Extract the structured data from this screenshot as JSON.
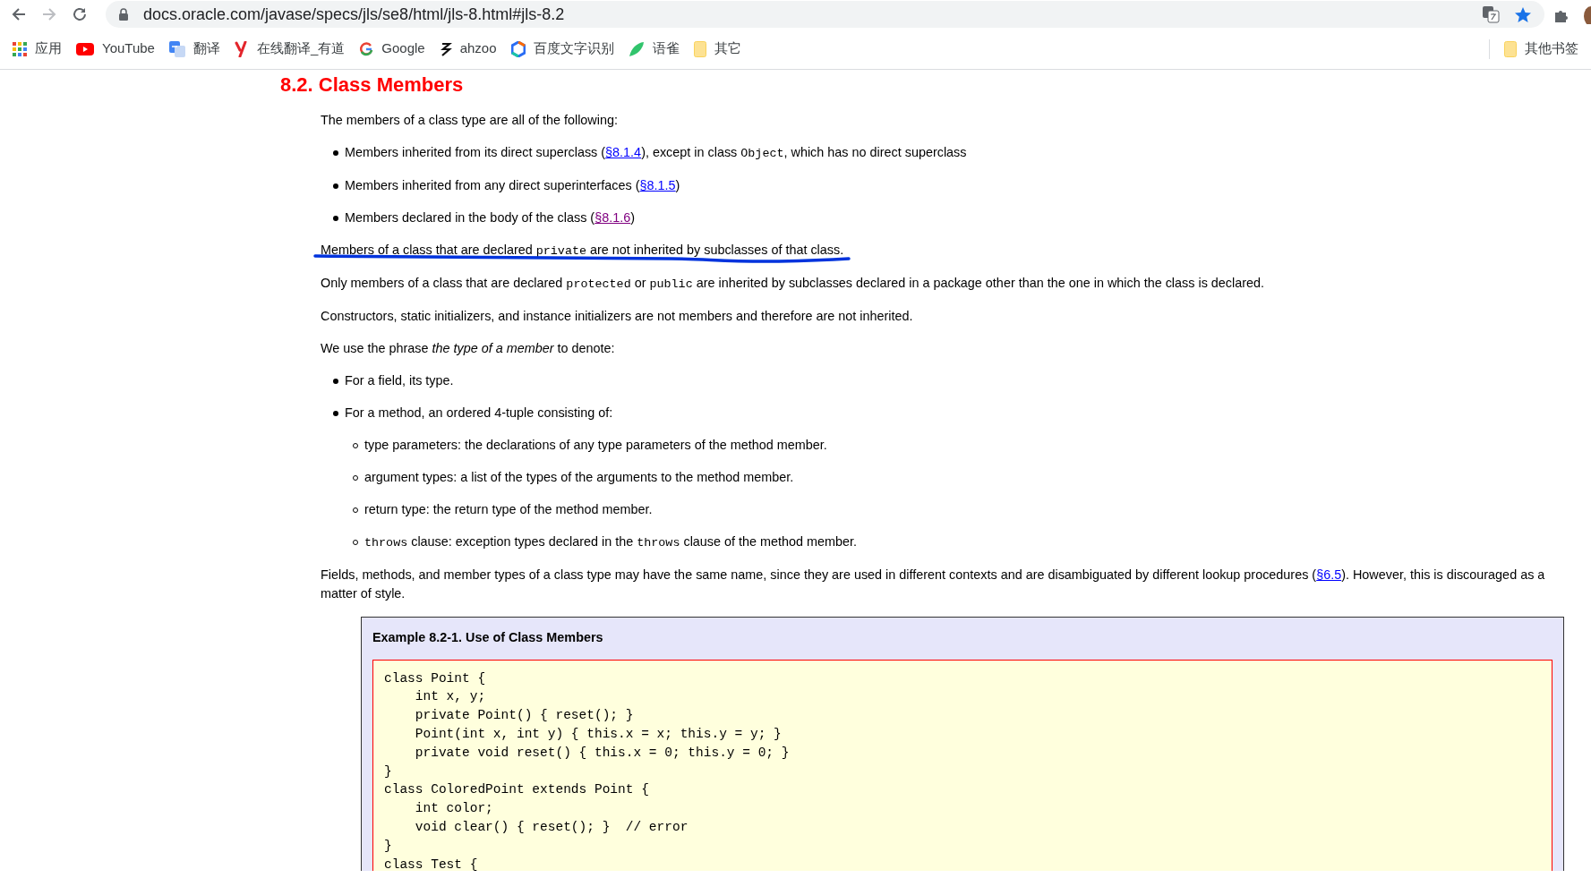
{
  "toolbar": {
    "nav": [
      {
        "kind": "back",
        "disabled": false
      },
      {
        "kind": "forward",
        "disabled": true
      },
      {
        "kind": "reload",
        "disabled": false
      }
    ],
    "url": "docs.oracle.com/javase/specs/jls/se8/html/jls-8.html#jls-8.2",
    "bookmarked": true
  },
  "bookmarks": [
    {
      "kind": "apps",
      "label": "应用"
    },
    {
      "kind": "youtube",
      "label": "YouTube"
    },
    {
      "kind": "translate",
      "label": "翻译"
    },
    {
      "kind": "youdao",
      "label": "在线翻译_有道"
    },
    {
      "kind": "google",
      "label": "Google"
    },
    {
      "kind": "ahzoo",
      "label": "ahzoo"
    },
    {
      "kind": "baidu",
      "label": "百度文字识别"
    },
    {
      "kind": "yuque",
      "label": "语雀"
    },
    {
      "kind": "folder",
      "label": "其它"
    }
  ],
  "other_bookmarks": {
    "label": "其他书签"
  },
  "heading": "8.2. Class Members",
  "blocks": [
    {
      "kind": "para",
      "segments": [
        {
          "kind": "text",
          "text": "The members of a class type are all of the following:"
        }
      ]
    },
    {
      "kind": "list",
      "items": [
        {
          "segments": [
            {
              "kind": "text",
              "text": "Members inherited from its direct superclass ("
            },
            {
              "kind": "link",
              "text": "§8.1.4",
              "visited": false
            },
            {
              "kind": "text",
              "text": "), except in class "
            },
            {
              "kind": "code",
              "text": "Object"
            },
            {
              "kind": "text",
              "text": ", which has no direct superclass"
            }
          ]
        },
        {
          "segments": [
            {
              "kind": "text",
              "text": "Members inherited from any direct superinterfaces ("
            },
            {
              "kind": "link",
              "text": "§8.1.5",
              "visited": false
            },
            {
              "kind": "text",
              "text": ")"
            }
          ]
        },
        {
          "segments": [
            {
              "kind": "text",
              "text": "Members declared in the body of the class ("
            },
            {
              "kind": "link",
              "text": "§8.1.6",
              "visited": true
            },
            {
              "kind": "text",
              "text": ")"
            }
          ]
        }
      ]
    },
    {
      "kind": "para",
      "pen_underline": true,
      "segments": [
        {
          "kind": "text",
          "text": "Members of a class that are declared "
        },
        {
          "kind": "code",
          "text": "private"
        },
        {
          "kind": "text",
          "text": " are not inherited by subclasses of that class."
        }
      ]
    },
    {
      "kind": "para",
      "segments": [
        {
          "kind": "text",
          "text": "Only members of a class that are declared "
        },
        {
          "kind": "code",
          "text": "protected"
        },
        {
          "kind": "text",
          "text": " or "
        },
        {
          "kind": "code",
          "text": "public"
        },
        {
          "kind": "text",
          "text": " are inherited by subclasses declared in a package other than the one in which the class is declared."
        }
      ]
    },
    {
      "kind": "para",
      "segments": [
        {
          "kind": "text",
          "text": "Constructors, static initializers, and instance initializers are not members and therefore are not inherited."
        }
      ]
    },
    {
      "kind": "para",
      "segments": [
        {
          "kind": "text",
          "text": "We use the phrase *the type of a member* to denote:"
        }
      ]
    },
    {
      "kind": "list",
      "items": [
        {
          "segments": [
            {
              "kind": "text",
              "text": "For a field, its type."
            }
          ]
        },
        {
          "segments": [
            {
              "kind": "text",
              "text": "For a method, an ordered 4-tuple consisting of:"
            }
          ],
          "children": [
            {
              "segments": [
                {
                  "kind": "text",
                  "text": "type parameters: the declarations of any type parameters of the method member."
                }
              ]
            },
            {
              "segments": [
                {
                  "kind": "text",
                  "text": "argument types: a list of the types of the arguments to the method member."
                }
              ]
            },
            {
              "segments": [
                {
                  "kind": "text",
                  "text": "return type: the return type of the method member."
                }
              ]
            },
            {
              "segments": [
                {
                  "kind": "code",
                  "text": "throws"
                },
                {
                  "kind": "text",
                  "text": " clause: exception types declared in the "
                },
                {
                  "kind": "code",
                  "text": "throws"
                },
                {
                  "kind": "text",
                  "text": " clause of the method member."
                }
              ]
            }
          ]
        }
      ]
    },
    {
      "kind": "para",
      "segments": [
        {
          "kind": "text",
          "text": "Fields, methods, and member types of a class type may have the same name, since they are used in different contexts and are disambiguated by different lookup procedures ("
        },
        {
          "kind": "link",
          "text": "§6.5",
          "visited": false
        },
        {
          "kind": "text",
          "text": "). However, this is discouraged as a matter of style."
        }
      ]
    }
  ],
  "example": {
    "title": "Example 8.2-1. Use of Class Members",
    "code_lines": [
      "class Point {",
      "    int x, y;",
      "    private Point() { reset(); }",
      "    Point(int x, int y) { this.x = x; this.y = y; }",
      "    private void reset() { this.x = 0; this.y = 0; }",
      "}",
      "class ColoredPoint extends Point {",
      "    int color;",
      "    void clear() { reset(); }  // error",
      "}",
      "class Test {"
    ]
  }
}
